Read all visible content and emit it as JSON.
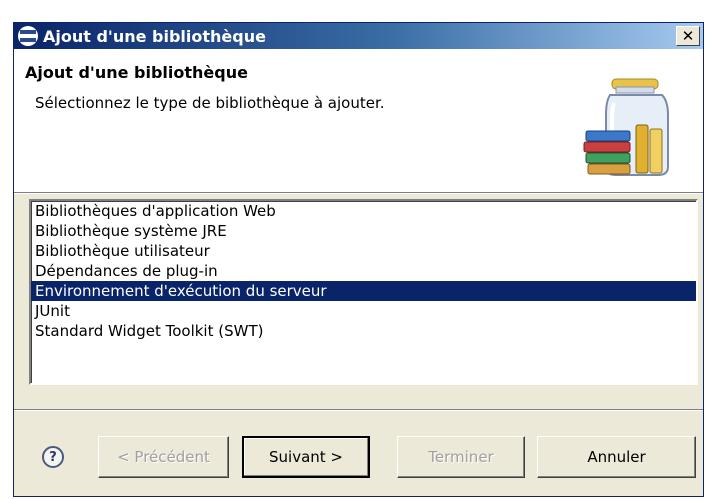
{
  "window": {
    "title": "Ajout d'une bibliothèque",
    "close_label": "✕"
  },
  "header": {
    "title": "Ajout d'une bibliothèque",
    "description": "Sélectionnez le type de bibliothèque à ajouter."
  },
  "library_types": {
    "items": [
      {
        "label": "Bibliothèques d'application Web",
        "selected": false
      },
      {
        "label": "Bibliothèque système JRE",
        "selected": false
      },
      {
        "label": "Bibliothèque utilisateur",
        "selected": false
      },
      {
        "label": "Dépendances de plug-in",
        "selected": false
      },
      {
        "label": "Environnement d'exécution du serveur",
        "selected": true
      },
      {
        "label": "JUnit",
        "selected": false
      },
      {
        "label": "Standard Widget Toolkit (SWT)",
        "selected": false
      }
    ]
  },
  "buttons": {
    "help_label": "?",
    "previous": {
      "label": "< Précédent",
      "enabled": false
    },
    "next": {
      "label": "Suivant >",
      "enabled": true
    },
    "finish": {
      "label": "Terminer",
      "enabled": false
    },
    "cancel": {
      "label": "Annuler",
      "enabled": true
    }
  },
  "icons": {
    "title": "eclipse-icon",
    "header": "library-jar-icon",
    "help": "help-icon"
  },
  "colors": {
    "selection": "#0a246a",
    "dialog_background": "#ece9d8",
    "title_gradient_start": "#0a246a",
    "title_gradient_end": "#a6caf0"
  }
}
